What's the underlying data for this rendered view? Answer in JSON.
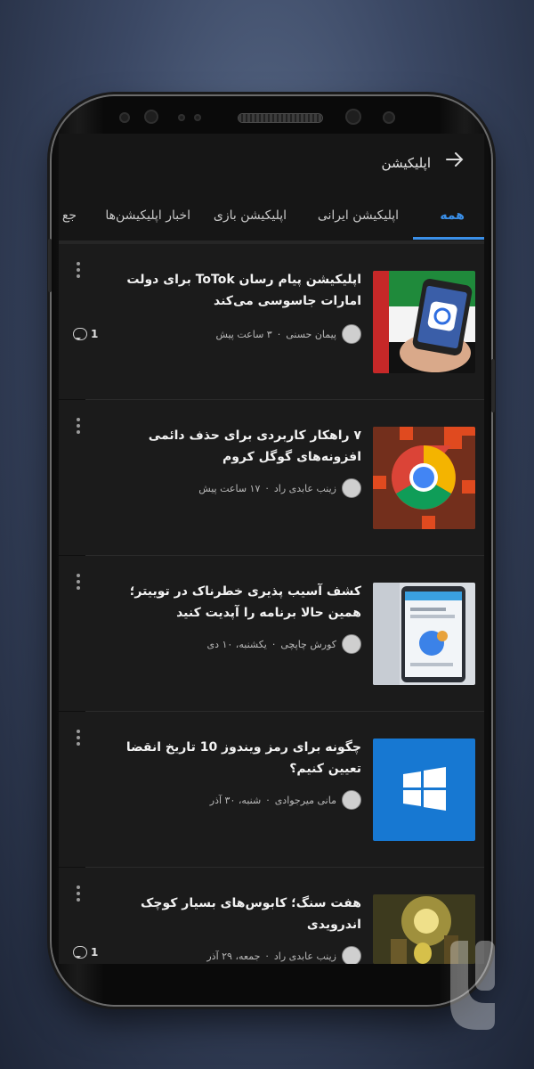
{
  "appbar": {
    "title": "اپلیکیشن",
    "back_icon": "arrow-right-icon"
  },
  "tabs": [
    {
      "label": "همه",
      "active": true
    },
    {
      "label": "اپلیکیشن ایرانی",
      "active": false
    },
    {
      "label": "اپلیکیشن بازی",
      "active": false
    },
    {
      "label": "اخبار اپلیکیشن‌ها",
      "active": false
    },
    {
      "label": "جع",
      "active": false
    }
  ],
  "accent_color": "#3a8fe8",
  "articles": [
    {
      "headline": "اپلیکیشن پیام رسان ToTok برای دولت امارات جاسوسی می‌کند",
      "author": "پیمان حسنی",
      "time": "۳ ساعت پیش",
      "comments": "1",
      "thumb_icon": "phone-app-icon"
    },
    {
      "headline": "۷ راهکار کاربردی برای حذف دائمی افزونه‌های گوگل کروم",
      "author": "زینب عابدی راد",
      "time": "۱۷ ساعت پیش",
      "comments": "",
      "thumb_icon": "chrome-icon"
    },
    {
      "headline": "کشف آسیب پذیری خطرناک در توییتر؛ همین حالا برنامه را آپدیت کنید",
      "author": "کورش چاپچی",
      "time": "یکشنبه، ۱۰ دی",
      "comments": "",
      "thumb_icon": "phone-screen-icon"
    },
    {
      "headline": "چگونه برای رمز ویندوز 10 تاریخ انقضا تعیین کنیم؟",
      "author": "مانی میرجوادی",
      "time": "شنبه، ۳۰ آذر",
      "comments": "",
      "thumb_icon": "windows-icon"
    },
    {
      "headline": "هفت سنگ؛ کابوس‌های بسیار کوچک اندرویدی",
      "author": "زینب عابدی راد",
      "time": "جمعه، ۲۹ آذر",
      "comments": "1",
      "thumb_icon": "game-art-icon"
    }
  ]
}
